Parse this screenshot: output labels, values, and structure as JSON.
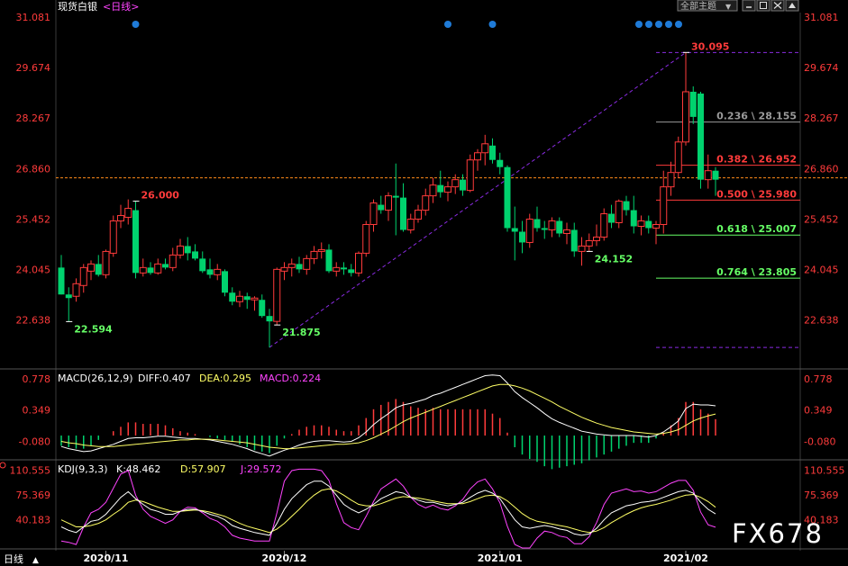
{
  "header": {
    "instrument": "现货白银",
    "period": "<日线>",
    "dropdown_label": "全部主题",
    "dropdown_arrow": "▼"
  },
  "watermark": "FX678",
  "footer": {
    "period_label": "日线",
    "period_arrow": "▲"
  },
  "colors": {
    "up": "#ff3b3b",
    "down": "#00d26e",
    "axis": "#ff3b3b",
    "grid": "#3a3a3a",
    "dashed_level": "#ff8c1a",
    "trend": "#8a2be2",
    "dot": "#1f7bd8",
    "diff": "#ffffff",
    "dea": "#ffff66",
    "macd_text": "#ff44ff",
    "kdj_j": "#ff44ff"
  },
  "chart_data": [
    {
      "type": "candlestick",
      "title": "现货白银 <日线>",
      "ylim": [
        21.3,
        31.081
      ],
      "y_ticks": [
        "31.081",
        "29.674",
        "28.267",
        "26.860",
        "25.452",
        "24.045",
        "22.638"
      ],
      "x_ticks": [
        "2020/11",
        "2020/12",
        "2021/01",
        "2021/02"
      ],
      "current_price_line": 26.6,
      "annotations": [
        {
          "label": "22.594",
          "kind": "low",
          "index": 1
        },
        {
          "label": "26.000",
          "kind": "high",
          "index": 10
        },
        {
          "label": "21.875",
          "kind": "low",
          "index": 29
        },
        {
          "label": "24.152",
          "kind": "low",
          "index": 71
        },
        {
          "label": "30.095",
          "kind": "high",
          "index": 84
        }
      ],
      "fib_levels": [
        {
          "label": "0.236 \\ 28.155",
          "value": 28.155,
          "color": "#9a9a9a"
        },
        {
          "label": "0.382 \\ 26.952",
          "value": 26.952,
          "color": "#ff3b3b"
        },
        {
          "label": "0.500 \\ 25.980",
          "value": 25.98,
          "color": "#ff3b3b"
        },
        {
          "label": "0.618 \\ 25.007",
          "value": 25.007,
          "color": "#66ff66"
        },
        {
          "label": "0.764 \\ 23.805",
          "value": 23.805,
          "color": "#66ff66"
        }
      ],
      "fib_top": 30.095,
      "fib_bottom": 21.875,
      "event_dot_indices": [
        10,
        52,
        58,
        76,
        77,
        78,
        79,
        80
      ],
      "candles": [
        [
          0,
          24.1,
          24.45,
          23.35,
          23.35
        ],
        [
          1,
          23.35,
          23.55,
          22.594,
          23.25
        ],
        [
          2,
          23.3,
          23.8,
          23.15,
          23.65
        ],
        [
          3,
          23.6,
          24.2,
          23.4,
          24.1
        ],
        [
          4,
          24.0,
          24.3,
          23.75,
          24.2
        ],
        [
          5,
          24.2,
          24.45,
          23.85,
          23.9
        ],
        [
          6,
          23.9,
          24.6,
          23.8,
          24.55
        ],
        [
          7,
          24.5,
          25.55,
          24.4,
          25.4
        ],
        [
          8,
          25.4,
          25.85,
          25.2,
          25.55
        ],
        [
          9,
          25.5,
          26.0,
          25.3,
          25.75
        ],
        [
          10,
          25.7,
          25.95,
          23.8,
          23.95
        ],
        [
          11,
          23.95,
          24.35,
          23.85,
          24.1
        ],
        [
          12,
          24.1,
          24.25,
          23.9,
          23.95
        ],
        [
          13,
          23.95,
          24.35,
          23.9,
          24.2
        ],
        [
          14,
          24.2,
          24.35,
          24.05,
          24.1
        ],
        [
          15,
          24.1,
          24.65,
          24.0,
          24.45
        ],
        [
          16,
          24.45,
          24.9,
          24.35,
          24.7
        ],
        [
          17,
          24.7,
          24.95,
          24.3,
          24.5
        ],
        [
          18,
          24.55,
          24.75,
          24.3,
          24.35
        ],
        [
          19,
          24.35,
          24.55,
          23.95,
          24.0
        ],
        [
          20,
          24.05,
          24.35,
          23.8,
          23.9
        ],
        [
          21,
          23.9,
          24.2,
          23.75,
          24.05
        ],
        [
          22,
          24.0,
          24.05,
          23.3,
          23.4
        ],
        [
          23,
          23.4,
          23.55,
          23.05,
          23.15
        ],
        [
          24,
          23.15,
          23.45,
          23.0,
          23.3
        ],
        [
          25,
          23.3,
          23.4,
          22.95,
          23.2
        ],
        [
          26,
          23.2,
          23.3,
          22.9,
          23.25
        ],
        [
          27,
          23.2,
          23.35,
          22.7,
          22.75
        ],
        [
          28,
          22.75,
          22.95,
          21.875,
          22.6
        ],
        [
          29,
          22.6,
          24.1,
          22.5,
          24.05
        ],
        [
          30,
          24.0,
          24.25,
          23.75,
          24.1
        ],
        [
          31,
          24.1,
          24.35,
          23.85,
          24.2
        ],
        [
          32,
          24.2,
          24.4,
          23.95,
          24.05
        ],
        [
          33,
          24.05,
          24.45,
          23.9,
          24.35
        ],
        [
          34,
          24.35,
          24.7,
          24.2,
          24.55
        ],
        [
          35,
          24.55,
          24.8,
          24.35,
          24.6
        ],
        [
          36,
          24.6,
          24.75,
          23.95,
          24.0
        ],
        [
          37,
          24.0,
          24.25,
          23.85,
          24.1
        ],
        [
          38,
          24.1,
          24.25,
          23.9,
          24.05
        ],
        [
          39,
          24.05,
          24.2,
          23.85,
          23.95
        ],
        [
          40,
          23.95,
          24.55,
          23.85,
          24.5
        ],
        [
          41,
          24.5,
          25.4,
          24.4,
          25.3
        ],
        [
          42,
          25.3,
          26.0,
          25.1,
          25.9
        ],
        [
          43,
          25.85,
          26.1,
          25.6,
          25.7
        ],
        [
          44,
          25.7,
          26.2,
          25.4,
          26.1
        ],
        [
          45,
          26.1,
          27.0,
          25.0,
          26.05
        ],
        [
          46,
          26.05,
          26.45,
          25.1,
          25.15
        ],
        [
          47,
          25.15,
          25.6,
          25.05,
          25.45
        ],
        [
          48,
          25.45,
          25.85,
          25.35,
          25.7
        ],
        [
          49,
          25.7,
          26.3,
          25.55,
          26.1
        ],
        [
          50,
          26.1,
          26.6,
          25.9,
          26.4
        ],
        [
          51,
          26.4,
          26.8,
          26.05,
          26.2
        ],
        [
          52,
          26.2,
          26.5,
          25.95,
          26.35
        ],
        [
          53,
          26.35,
          26.7,
          26.15,
          26.55
        ],
        [
          54,
          26.55,
          26.7,
          26.1,
          26.25
        ],
        [
          55,
          26.25,
          27.25,
          26.2,
          27.1
        ],
        [
          56,
          27.1,
          27.4,
          26.8,
          27.3
        ],
        [
          57,
          27.3,
          27.8,
          26.95,
          27.55
        ],
        [
          58,
          27.5,
          27.7,
          27.0,
          27.1
        ],
        [
          59,
          27.1,
          27.3,
          26.7,
          26.9
        ],
        [
          60,
          26.9,
          26.95,
          25.1,
          25.2
        ],
        [
          61,
          25.2,
          25.8,
          24.3,
          25.1
        ],
        [
          62,
          25.1,
          25.4,
          24.5,
          24.8
        ],
        [
          63,
          24.8,
          25.6,
          24.65,
          25.45
        ],
        [
          64,
          25.45,
          25.8,
          25.1,
          25.2
        ],
        [
          65,
          25.2,
          25.4,
          24.9,
          25.15
        ],
        [
          66,
          25.15,
          25.5,
          24.95,
          25.4
        ],
        [
          67,
          25.4,
          25.5,
          24.95,
          25.05
        ],
        [
          68,
          25.05,
          25.35,
          24.75,
          25.15
        ],
        [
          69,
          25.15,
          25.35,
          24.4,
          24.55
        ],
        [
          70,
          24.55,
          24.95,
          24.152,
          24.7
        ],
        [
          71,
          24.7,
          25.05,
          24.55,
          24.85
        ],
        [
          72,
          24.85,
          25.3,
          24.7,
          24.95
        ],
        [
          73,
          24.95,
          25.75,
          24.85,
          25.6
        ],
        [
          74,
          25.6,
          25.85,
          25.2,
          25.35
        ],
        [
          75,
          25.35,
          26.0,
          25.2,
          25.95
        ],
        [
          76,
          25.95,
          26.1,
          25.55,
          25.7
        ],
        [
          77,
          25.7,
          26.1,
          25.05,
          25.25
        ],
        [
          78,
          25.25,
          25.55,
          25.0,
          25.4
        ],
        [
          79,
          25.4,
          25.55,
          25.05,
          25.2
        ],
        [
          80,
          25.2,
          25.4,
          24.75,
          25.3
        ],
        [
          81,
          25.3,
          26.8,
          25.05,
          26.35
        ],
        [
          82,
          26.35,
          27.05,
          26.1,
          26.75
        ],
        [
          83,
          26.75,
          27.75,
          26.6,
          27.6
        ],
        [
          84,
          27.6,
          30.095,
          27.5,
          29.0
        ],
        [
          85,
          29.0,
          29.15,
          28.1,
          28.3
        ],
        [
          86,
          28.95,
          29.0,
          26.3,
          26.55
        ],
        [
          87,
          26.55,
          27.25,
          26.3,
          26.8
        ],
        [
          88,
          26.8,
          26.9,
          26.1,
          26.55
        ]
      ]
    },
    {
      "type": "macd",
      "title": "MACD(26,12,9)",
      "diff_label": "DIFF:0.407",
      "dea_label": "DEA:0.295",
      "macd_label": "MACD:0.224",
      "series": [
        {
          "name": "DIFF",
          "values": [
            -0.15,
            -0.18,
            -0.2,
            -0.22,
            -0.21,
            -0.18,
            -0.15,
            -0.12,
            -0.08,
            -0.04,
            -0.03,
            -0.03,
            -0.02,
            -0.01,
            -0.01,
            -0.02,
            -0.03,
            -0.04,
            -0.04,
            -0.05,
            -0.06,
            -0.08,
            -0.1,
            -0.12,
            -0.15,
            -0.18,
            -0.22,
            -0.25,
            -0.28,
            -0.24,
            -0.2,
            -0.17,
            -0.13,
            -0.1,
            -0.08,
            -0.07,
            -0.07,
            -0.08,
            -0.09,
            -0.08,
            -0.03,
            0.05,
            0.15,
            0.23,
            0.3,
            0.38,
            0.42,
            0.44,
            0.47,
            0.5,
            0.55,
            0.58,
            0.62,
            0.66,
            0.7,
            0.74,
            0.78,
            0.82,
            0.83,
            0.82,
            0.72,
            0.6,
            0.52,
            0.45,
            0.38,
            0.3,
            0.23,
            0.18,
            0.14,
            0.1,
            0.06,
            0.04,
            0.02,
            0.01,
            0.0,
            0.0,
            0.0,
            0.0,
            -0.01,
            -0.02,
            0.0,
            0.05,
            0.12,
            0.2,
            0.37,
            0.43,
            0.42,
            0.42,
            0.407
          ]
        },
        {
          "name": "DEA",
          "values": [
            -0.08,
            -0.1,
            -0.11,
            -0.13,
            -0.14,
            -0.15,
            -0.15,
            -0.15,
            -0.14,
            -0.13,
            -0.12,
            -0.11,
            -0.1,
            -0.09,
            -0.08,
            -0.07,
            -0.06,
            -0.06,
            -0.05,
            -0.05,
            -0.05,
            -0.06,
            -0.07,
            -0.08,
            -0.09,
            -0.1,
            -0.12,
            -0.14,
            -0.16,
            -0.17,
            -0.18,
            -0.18,
            -0.17,
            -0.16,
            -0.15,
            -0.14,
            -0.13,
            -0.12,
            -0.12,
            -0.11,
            -0.1,
            -0.07,
            -0.03,
            0.02,
            0.07,
            0.13,
            0.19,
            0.24,
            0.28,
            0.32,
            0.36,
            0.4,
            0.44,
            0.48,
            0.52,
            0.56,
            0.6,
            0.64,
            0.68,
            0.7,
            0.7,
            0.68,
            0.65,
            0.61,
            0.56,
            0.51,
            0.46,
            0.4,
            0.35,
            0.3,
            0.25,
            0.21,
            0.17,
            0.14,
            0.11,
            0.09,
            0.07,
            0.05,
            0.04,
            0.03,
            0.02,
            0.03,
            0.05,
            0.08,
            0.14,
            0.2,
            0.24,
            0.27,
            0.295
          ]
        }
      ],
      "y_ticks": [
        "0.778",
        "0.349",
        "-0.080"
      ],
      "ylim": [
        -0.32,
        0.9
      ]
    },
    {
      "type": "kdj",
      "title": "KDJ(9,3,3)",
      "k_label": "K:48.462",
      "d_label": "D:57.907",
      "j_label": "J:29.572",
      "series": [
        {
          "name": "K",
          "values": [
            30,
            25,
            22,
            30,
            38,
            40,
            48,
            60,
            72,
            80,
            70,
            62,
            55,
            52,
            48,
            48,
            52,
            55,
            55,
            52,
            48,
            45,
            40,
            32,
            28,
            25,
            22,
            20,
            18,
            35,
            55,
            70,
            80,
            90,
            95,
            95,
            88,
            75,
            62,
            55,
            50,
            55,
            62,
            70,
            75,
            80,
            78,
            72,
            68,
            65,
            65,
            62,
            60,
            62,
            65,
            72,
            78,
            82,
            78,
            70,
            55,
            40,
            30,
            28,
            30,
            32,
            30,
            27,
            25,
            20,
            18,
            20,
            28,
            40,
            50,
            55,
            60,
            62,
            65,
            66,
            68,
            72,
            76,
            80,
            82,
            78,
            65,
            55,
            48.462
          ]
        },
        {
          "name": "D",
          "values": [
            40,
            35,
            30,
            30,
            32,
            35,
            40,
            48,
            55,
            65,
            68,
            66,
            62,
            58,
            55,
            52,
            52,
            53,
            54,
            53,
            51,
            48,
            45,
            40,
            35,
            31,
            28,
            25,
            22,
            27,
            35,
            45,
            55,
            66,
            75,
            82,
            84,
            81,
            75,
            68,
            62,
            60,
            60,
            63,
            67,
            71,
            73,
            72,
            71,
            69,
            67,
            65,
            63,
            63,
            63,
            66,
            70,
            74,
            75,
            73,
            67,
            58,
            49,
            42,
            38,
            36,
            34,
            32,
            30,
            27,
            24,
            22,
            24,
            29,
            36,
            42,
            48,
            53,
            57,
            60,
            62,
            65,
            68,
            72,
            75,
            76,
            72,
            66,
            57.907
          ]
        },
        {
          "name": "J",
          "values": [
            10,
            8,
            5,
            30,
            50,
            55,
            65,
            85,
            105,
            110,
            75,
            55,
            45,
            40,
            35,
            40,
            52,
            58,
            57,
            50,
            42,
            38,
            30,
            18,
            14,
            12,
            10,
            10,
            10,
            50,
            95,
            110,
            112,
            112,
            112,
            110,
            96,
            63,
            36,
            29,
            26,
            45,
            66,
            84,
            91,
            98,
            88,
            72,
            62,
            57,
            61,
            56,
            54,
            60,
            69,
            84,
            94,
            98,
            84,
            64,
            31,
            5,
            0,
            0,
            14,
            24,
            22,
            17,
            15,
            6,
            6,
            16,
            36,
            62,
            78,
            81,
            84,
            80,
            81,
            78,
            80,
            86,
            92,
            96,
            96,
            82,
            51,
            33,
            29.572
          ]
        }
      ],
      "y_ticks": [
        "110.555",
        "75.369",
        "40.183"
      ],
      "ylim": [
        0,
        124
      ]
    }
  ]
}
